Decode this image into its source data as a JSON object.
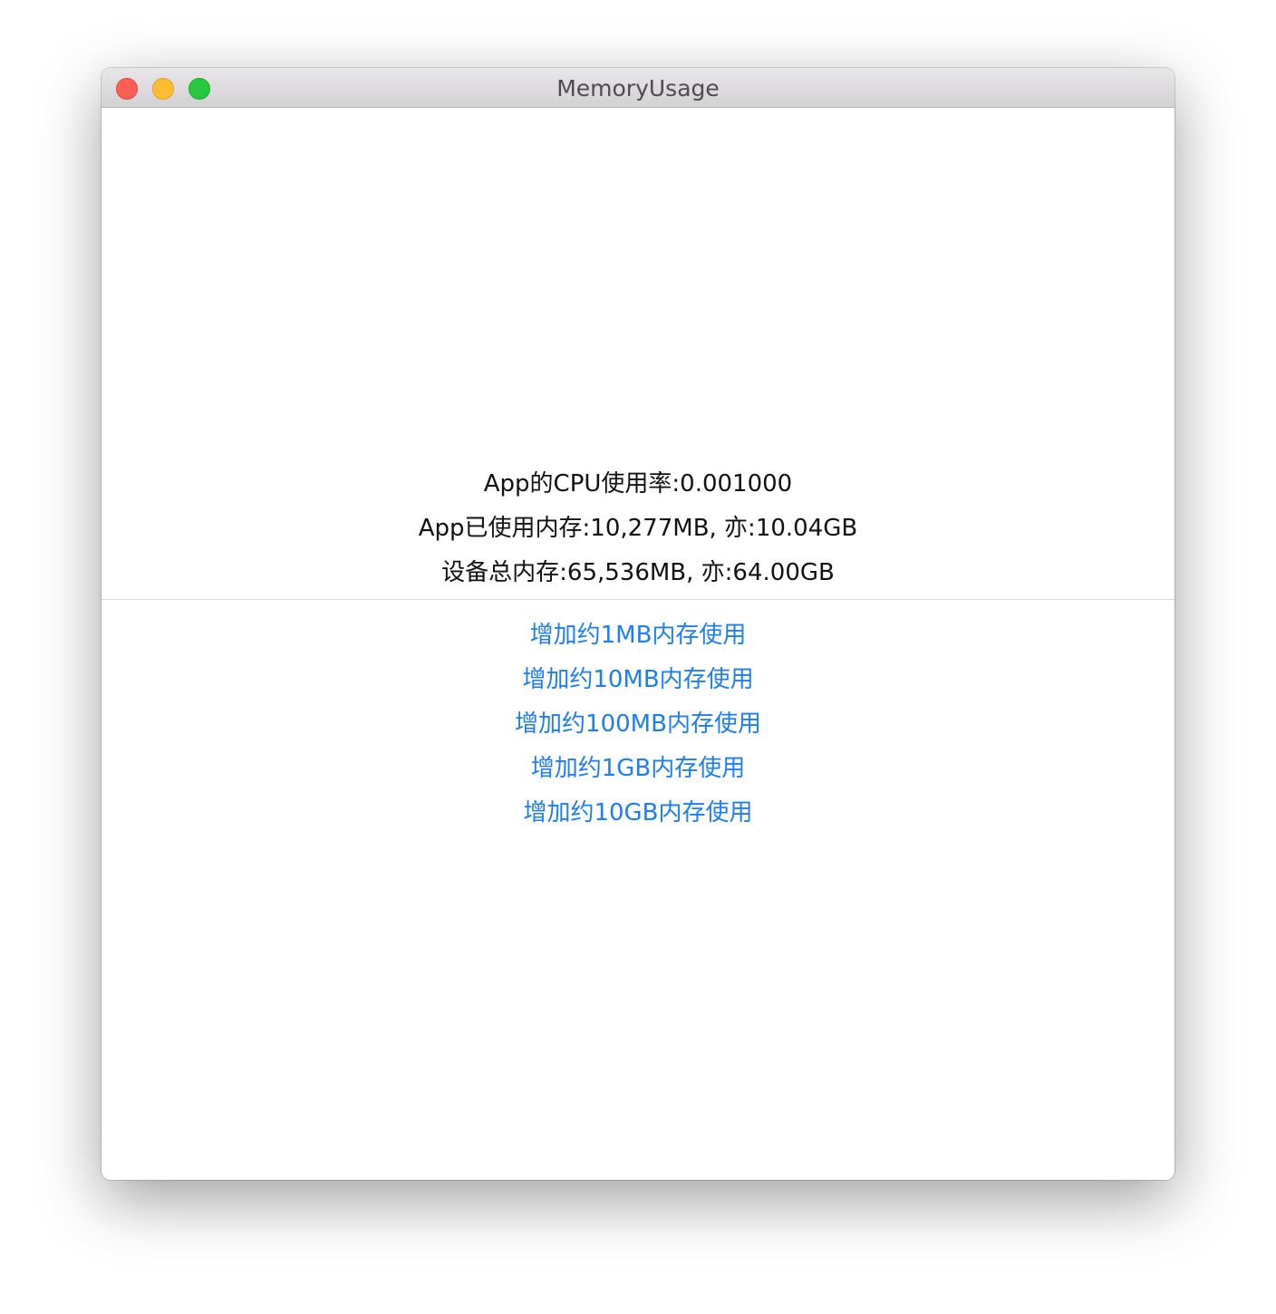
{
  "window": {
    "title": "MemoryUsage"
  },
  "stats": {
    "cpu_usage": "App的CPU使用率:0.001000",
    "app_memory": "App已使用内存:10,277MB, 亦:10.04GB",
    "device_memory": "设备总内存:65,536MB, 亦:64.00GB"
  },
  "actions": [
    {
      "label": "增加约1MB内存使用"
    },
    {
      "label": "增加约10MB内存使用"
    },
    {
      "label": "增加约100MB内存使用"
    },
    {
      "label": "增加约1GB内存使用"
    },
    {
      "label": "增加约10GB内存使用"
    }
  ],
  "colors": {
    "link": "#1b7ef2",
    "close": "#fe5f57",
    "minimize": "#febc2e",
    "zoom": "#28c840"
  }
}
